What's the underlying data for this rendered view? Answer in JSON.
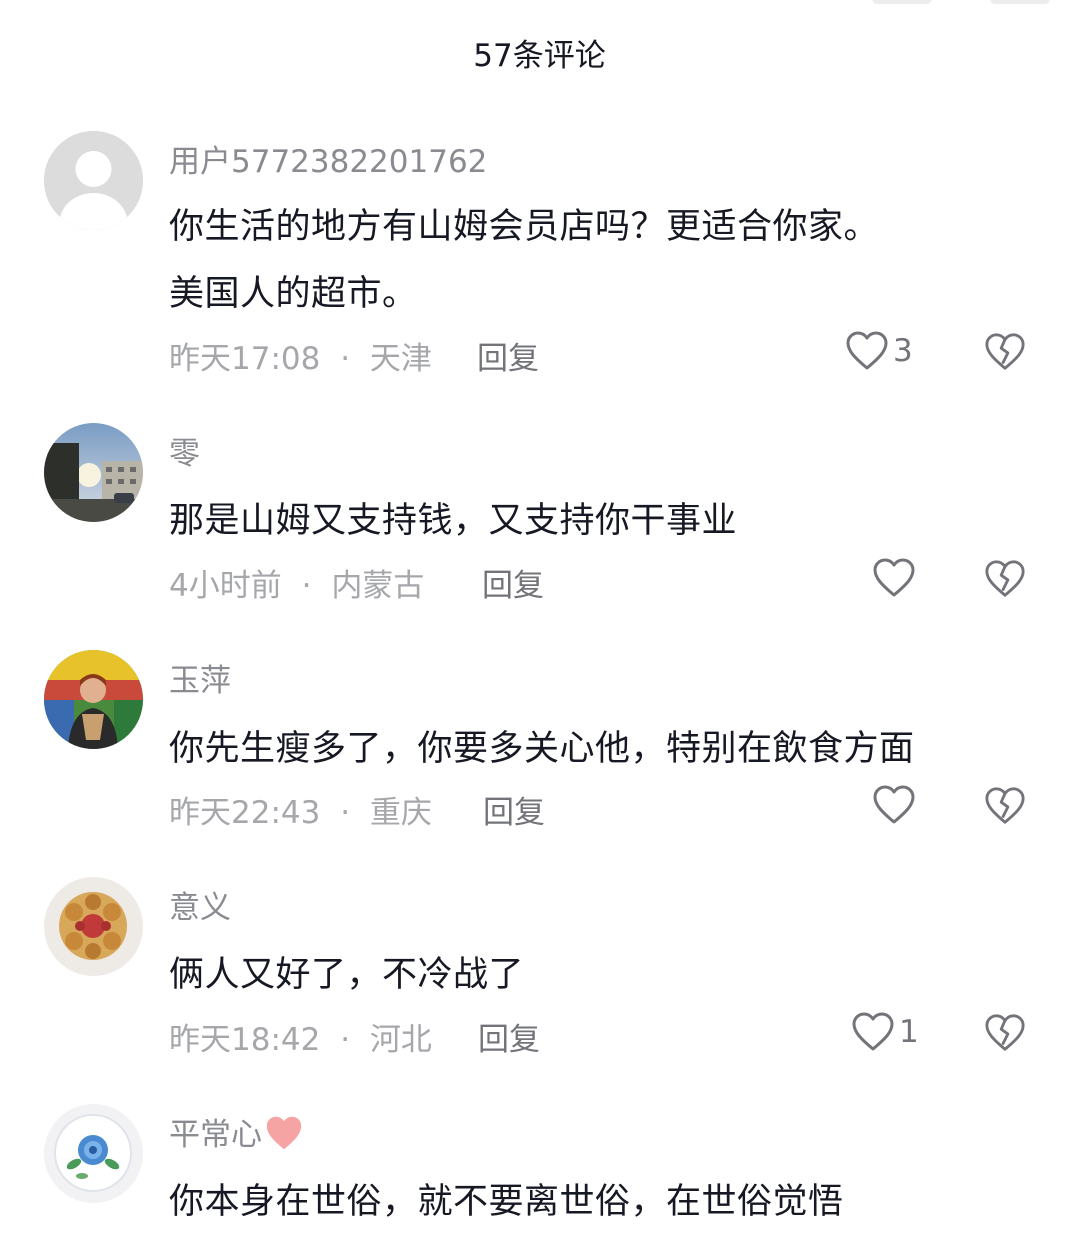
{
  "header": {
    "title": "57条评论"
  },
  "comments": [
    {
      "username": "用户5772382201762",
      "lines": [
        "你生活的地方有山姆会员店吗？更适合你家。",
        "美国人的超市。"
      ],
      "time": "昨天17:08",
      "separator": "·",
      "location": "天津",
      "reply_label": "回复",
      "likes": "3",
      "avatar": "default-user-avatar"
    },
    {
      "username": "零",
      "lines": [
        "那是山姆又支持钱，又支持你干事业"
      ],
      "time": "4小时前",
      "separator": "·",
      "location": "内蒙古",
      "reply_label": "回复",
      "likes": "",
      "avatar": "street-photo-avatar"
    },
    {
      "username": "玉萍",
      "lines": [
        "你先生瘦多了，你要多关心他，特别在飲食方面"
      ],
      "time": "昨天22:43",
      "separator": "·",
      "location": "重庆",
      "reply_label": "回复",
      "likes": "",
      "avatar": "woman-photo-avatar"
    },
    {
      "username": "意义",
      "lines": [
        "俩人又好了，不冷战了"
      ],
      "time": "昨天18:42",
      "separator": "·",
      "location": "河北",
      "reply_label": "回复",
      "likes": "1",
      "avatar": "food-photo-avatar"
    },
    {
      "username": "平常心",
      "lines": [
        "你本身在世俗，就不要离世俗，在世俗觉悟"
      ],
      "avatar": "flower-plate-avatar",
      "username_emoji": "pink-heart-icon"
    }
  ],
  "colors": {
    "primary_text": "#161823",
    "secondary_text": "#8a8b91",
    "icon": "#73747a",
    "pink_heart": "#f5a3a3"
  }
}
